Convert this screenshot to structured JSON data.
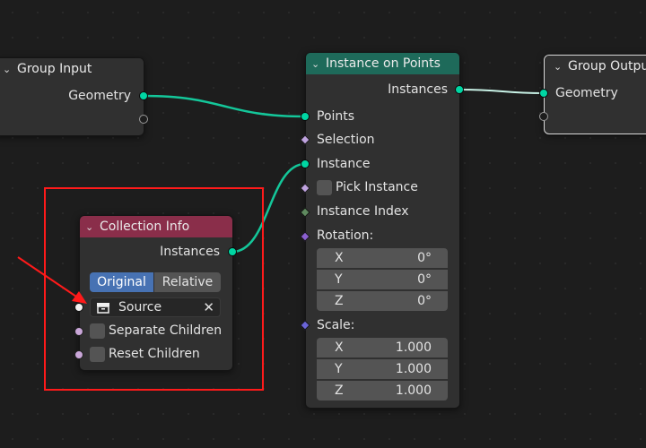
{
  "nodes": {
    "group_input": {
      "title": "Group Input",
      "output": "Geometry"
    },
    "group_output": {
      "title": "Group Output",
      "input": "Geometry"
    },
    "instance_on_points": {
      "title": "Instance on Points",
      "output": "Instances",
      "points": "Points",
      "selection": "Selection",
      "instance": "Instance",
      "pick_instance": "Pick Instance",
      "instance_index": "Instance Index",
      "rotation_label": "Rotation:",
      "rotation": [
        {
          "axis": "X",
          "value": "0°"
        },
        {
          "axis": "Y",
          "value": "0°"
        },
        {
          "axis": "Z",
          "value": "0°"
        }
      ],
      "scale_label": "Scale:",
      "scale": [
        {
          "axis": "X",
          "value": "1.000"
        },
        {
          "axis": "Y",
          "value": "1.000"
        },
        {
          "axis": "Z",
          "value": "1.000"
        }
      ]
    },
    "collection_info": {
      "title": "Collection Info",
      "output": "Instances",
      "transform_options": [
        "Original",
        "Relative"
      ],
      "selected_option": "Original",
      "collection_placeholder": "Source",
      "separate_children": "Separate Children",
      "reset_children": "Reset Children"
    }
  },
  "colors": {
    "geometry_header": "#1e6a5a",
    "input_header": "#8a2e4a",
    "selected_toggle": "#4772b3",
    "link": "#14c79a",
    "annotation": "#ff1a1a"
  },
  "icons": [
    "chevron-down-icon",
    "collection-box-icon",
    "close-icon",
    "arrow-annotation"
  ]
}
